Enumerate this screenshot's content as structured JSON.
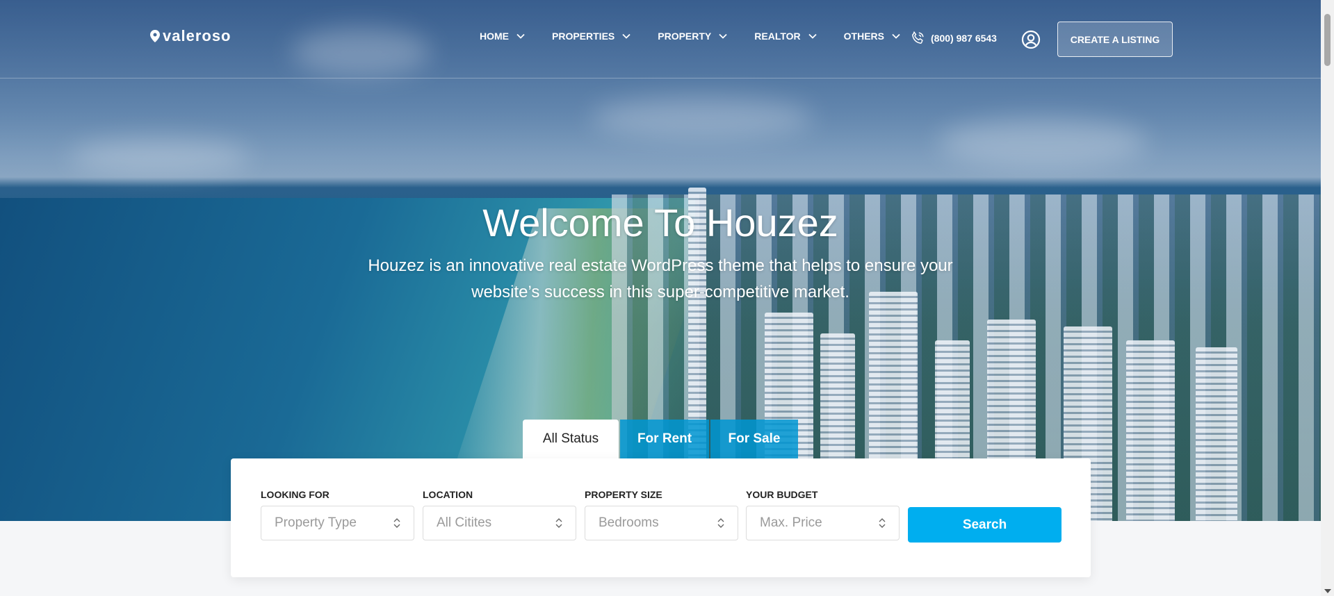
{
  "header": {
    "logo_text": "valeroso",
    "nav": [
      {
        "label": "HOME"
      },
      {
        "label": "PROPERTIES"
      },
      {
        "label": "PROPERTY"
      },
      {
        "label": "REALTOR"
      },
      {
        "label": "OTHERS"
      }
    ],
    "phone": "(800) 987 6543",
    "create_listing": "CREATE A LISTING"
  },
  "hero": {
    "title": "Welcome To Houzez",
    "subtitle": "Houzez is an innovative real estate WordPress theme that helps to ensure your website’s success in this super-competitive market."
  },
  "tabs": [
    {
      "label": "All Status",
      "active": true
    },
    {
      "label": "For Rent",
      "active": false
    },
    {
      "label": "For Sale",
      "active": false
    }
  ],
  "search": {
    "fields": [
      {
        "label": "LOOKING FOR",
        "placeholder": "Property Type"
      },
      {
        "label": "LOCATION",
        "placeholder": "All Citites"
      },
      {
        "label": "PROPERTY SIZE",
        "placeholder": "Bedrooms"
      },
      {
        "label": "YOUR BUDGET",
        "placeholder": "Max. Price"
      }
    ],
    "button": "Search"
  },
  "colors": {
    "accent": "#00aeef",
    "tab_blue": "#0096d2"
  }
}
